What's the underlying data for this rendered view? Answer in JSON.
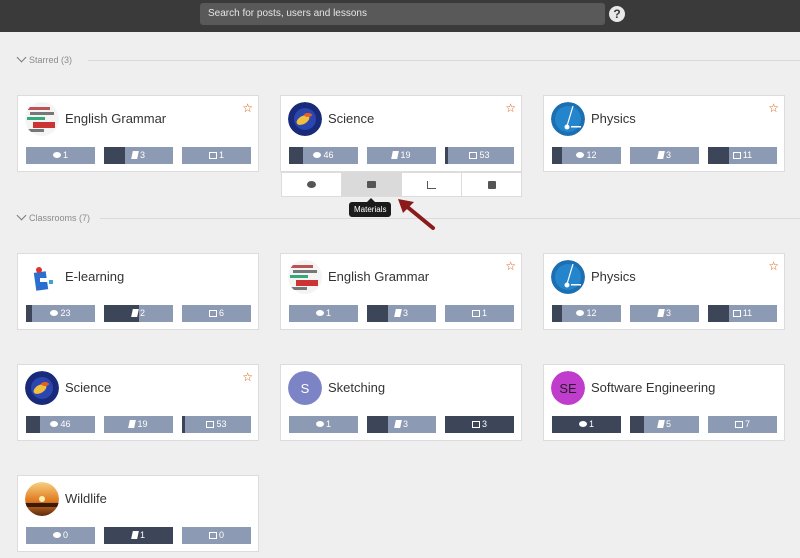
{
  "header": {
    "search_placeholder": "Search for posts, users and lessons",
    "help_label": "?"
  },
  "sections": {
    "starred": {
      "title": "Starred (3)"
    },
    "classrooms": {
      "title": "Classrooms (7)"
    }
  },
  "starred": [
    {
      "title": "English Grammar",
      "avatar": "english-grammar-image",
      "starred": true,
      "stats": [
        {
          "icon": "chat-icon",
          "value": "1",
          "fill": 0
        },
        {
          "icon": "book-icon",
          "value": "3",
          "fill": 0.3
        },
        {
          "icon": "list-icon",
          "value": "1",
          "fill": 0
        }
      ]
    },
    {
      "title": "Science",
      "avatar": "science-image",
      "starred": true,
      "stats": [
        {
          "icon": "chat-icon",
          "value": "46",
          "fill": 0.2
        },
        {
          "icon": "book-icon",
          "value": "19",
          "fill": 0
        },
        {
          "icon": "list-icon",
          "value": "53",
          "fill": 0.03
        }
      ]
    },
    {
      "title": "Physics",
      "avatar": "physics-image",
      "starred": true,
      "stats": [
        {
          "icon": "chat-icon",
          "value": "12",
          "fill": 0.15
        },
        {
          "icon": "book-icon",
          "value": "3",
          "fill": 0
        },
        {
          "icon": "list-icon",
          "value": "11",
          "fill": 0.3
        }
      ]
    }
  ],
  "course_tabs": {
    "tabs": [
      {
        "icon": "comments-icon",
        "name": "comments"
      },
      {
        "icon": "folder-icon",
        "name": "materials"
      },
      {
        "icon": "bar-chart-icon",
        "name": "reports"
      },
      {
        "icon": "checkbox-icon",
        "name": "assignments"
      }
    ],
    "tooltip": "Materials"
  },
  "classrooms": [
    {
      "title": "E-learning",
      "avatar": "elearning-image",
      "starred": false,
      "stats": [
        {
          "icon": "chat-icon",
          "value": "23",
          "fill": 0.08
        },
        {
          "icon": "book-icon",
          "value": "2",
          "fill": 0.5
        },
        {
          "icon": "list-icon",
          "value": "6",
          "fill": 0
        }
      ]
    },
    {
      "title": "English Grammar",
      "avatar": "english-grammar-image",
      "starred": true,
      "stats": [
        {
          "icon": "chat-icon",
          "value": "1",
          "fill": 0
        },
        {
          "icon": "book-icon",
          "value": "3",
          "fill": 0.3
        },
        {
          "icon": "list-icon",
          "value": "1",
          "fill": 0
        }
      ]
    },
    {
      "title": "Physics",
      "avatar": "physics-image",
      "starred": true,
      "stats": [
        {
          "icon": "chat-icon",
          "value": "12",
          "fill": 0.15
        },
        {
          "icon": "book-icon",
          "value": "3",
          "fill": 0
        },
        {
          "icon": "list-icon",
          "value": "11",
          "fill": 0.3
        }
      ]
    },
    {
      "title": "Science",
      "avatar": "science-image",
      "starred": true,
      "stats": [
        {
          "icon": "chat-icon",
          "value": "46",
          "fill": 0.2
        },
        {
          "icon": "book-icon",
          "value": "19",
          "fill": 0
        },
        {
          "icon": "list-icon",
          "value": "53",
          "fill": 0.03
        }
      ]
    },
    {
      "title": "Sketching",
      "avatar": "sketching-letter",
      "avatar_letter": "S",
      "avatar_color": "#7c84c6",
      "avatar_text_color": "#ffffff",
      "starred": false,
      "stats": [
        {
          "icon": "chat-icon",
          "value": "1",
          "fill": 0
        },
        {
          "icon": "book-icon",
          "value": "3",
          "fill": 0.3
        },
        {
          "icon": "list-icon",
          "value": "3",
          "fill": 1
        }
      ]
    },
    {
      "title": "Software Engineering",
      "avatar": "software-engineering-letter",
      "avatar_letter": "SE",
      "avatar_color": "#c03ccc",
      "avatar_text_color": "#222222",
      "starred": false,
      "stats": [
        {
          "icon": "chat-icon",
          "value": "1",
          "fill": 1
        },
        {
          "icon": "book-icon",
          "value": "5",
          "fill": 0.2
        },
        {
          "icon": "list-icon",
          "value": "7",
          "fill": 0
        }
      ]
    },
    {
      "title": "Wildlife",
      "avatar": "wildlife-image",
      "starred": false,
      "stats": [
        {
          "icon": "chat-icon",
          "value": "0",
          "fill": 0
        },
        {
          "icon": "book-icon",
          "value": "1",
          "fill": 1
        },
        {
          "icon": "list-icon",
          "value": "0",
          "fill": 0
        }
      ]
    }
  ],
  "colors": {
    "topbar": "#3a3a3a",
    "background": "#efefef",
    "stat_light": "#8d9ab4",
    "stat_dark": "#3d4658",
    "star": "#d35400",
    "annotation_arrow": "#8b1a1a"
  }
}
